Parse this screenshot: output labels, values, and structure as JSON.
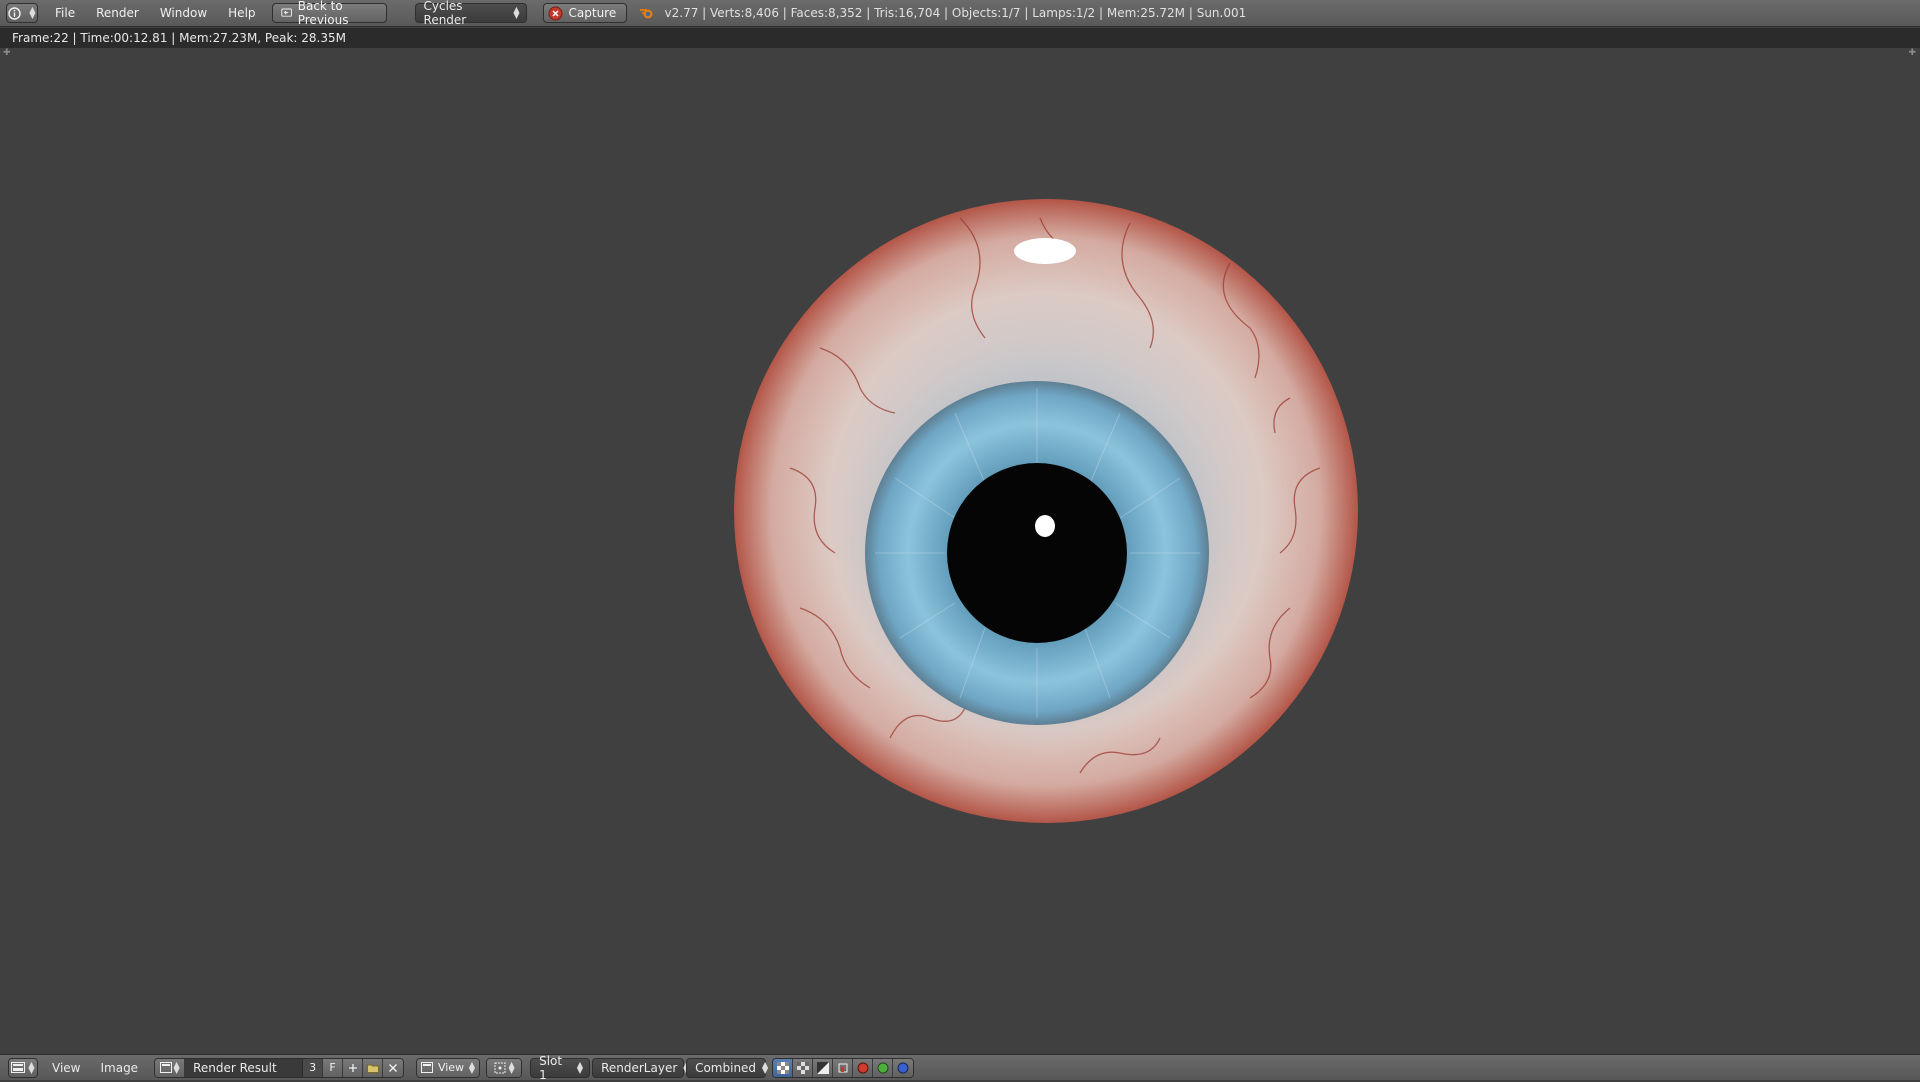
{
  "topbar": {
    "menu": [
      "File",
      "Render",
      "Window",
      "Help"
    ],
    "back_label": "Back to Previous",
    "engine": "Cycles Render",
    "capture_label": "Capture",
    "stats": "v2.77 | Verts:8,406 | Faces:8,352 | Tris:16,704 | Objects:1/7 | Lamps:1/2 | Mem:25.72M | Sun.001"
  },
  "infobar": {
    "text": "Frame:22 | Time:00:12.81 | Mem:27.23M, Peak: 28.35M"
  },
  "bottombar": {
    "view_menu": "View",
    "image_menu": "Image",
    "image_name": "Render Result",
    "users_count": "3",
    "fake_user": "F",
    "view_dropdown": "View",
    "slot": "Slot 1",
    "render_layer": "RenderLayer",
    "pass": "Combined"
  },
  "colors": {
    "accent_capture": "#c0392b",
    "iris": "#6fa6c4",
    "sclera": "#d9c7c2",
    "background": "#404041"
  }
}
